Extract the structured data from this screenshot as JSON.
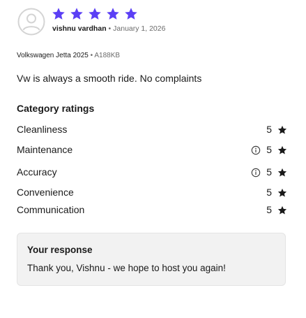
{
  "review": {
    "rating": 5,
    "rating_max": 5,
    "star_color": "#5b3ff5",
    "reviewer_name": "vishnu vardhan",
    "separator": "•",
    "date": "January 1, 2026",
    "avatar_icon": "user-placeholder-icon"
  },
  "vehicle": {
    "model": "Volkswagen Jetta 2025",
    "separator": "•",
    "plate": "A188KB"
  },
  "review_text": "Vw is always a smooth ride. No complaints",
  "categories": {
    "title": "Category ratings",
    "items": [
      {
        "label": "Cleanliness",
        "value": "5",
        "info_icon": false
      },
      {
        "label": "Maintenance",
        "value": "5",
        "info_icon": true
      },
      {
        "label": "Accuracy",
        "value": "5",
        "info_icon": true
      },
      {
        "label": "Convenience",
        "value": "5",
        "info_icon": false
      },
      {
        "label": "Communication",
        "value": "5",
        "info_icon": false
      }
    ]
  },
  "response": {
    "title": "Your response",
    "text": "Thank you, Vishnu - we hope to host you again!"
  }
}
